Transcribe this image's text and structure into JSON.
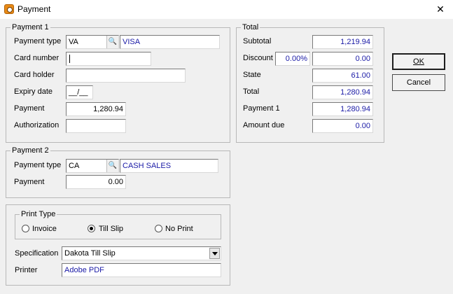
{
  "window": {
    "title": "Payment",
    "close_glyph": "✕"
  },
  "payment1": {
    "legend": "Payment 1",
    "payment_type_label": "Payment type",
    "payment_type_code": "VA",
    "payment_type_name": "VISA",
    "card_number_label": "Card number",
    "card_number_value": "",
    "card_holder_label": "Card holder",
    "card_holder_value": "",
    "expiry_label": "Expiry date",
    "expiry_value": "__/__",
    "payment_label": "Payment",
    "payment_value": "1,280.94",
    "authorization_label": "Authorization",
    "authorization_value": ""
  },
  "payment2": {
    "legend": "Payment 2",
    "payment_type_label": "Payment type",
    "payment_type_code": "CA",
    "payment_type_name": "CASH SALES",
    "payment_label": "Payment",
    "payment_value": "0.00"
  },
  "total": {
    "legend": "Total",
    "subtotal_label": "Subtotal",
    "subtotal_value": "1,219.94",
    "discount_label": "Discount",
    "discount_percent": "0.00%",
    "discount_value": "0.00",
    "state_label": "State",
    "state_value": "61.00",
    "total_label": "Total",
    "total_value": "1,280.94",
    "payment1_label": "Payment 1",
    "payment1_value": "1,280.94",
    "amount_due_label": "Amount due",
    "amount_due_value": "0.00"
  },
  "buttons": {
    "ok": "OK",
    "cancel": "Cancel"
  },
  "print": {
    "print_type_legend": "Print Type",
    "options": [
      "Invoice",
      "Till Slip",
      "No Print"
    ],
    "selected": "Till Slip",
    "specification_label": "Specification",
    "specification_value": "Dakota Till Slip",
    "printer_label": "Printer",
    "printer_value": "Adobe PDF"
  },
  "colors": {
    "accent_text": "#1a1aa6",
    "window_bg": "#f0f0f0"
  }
}
